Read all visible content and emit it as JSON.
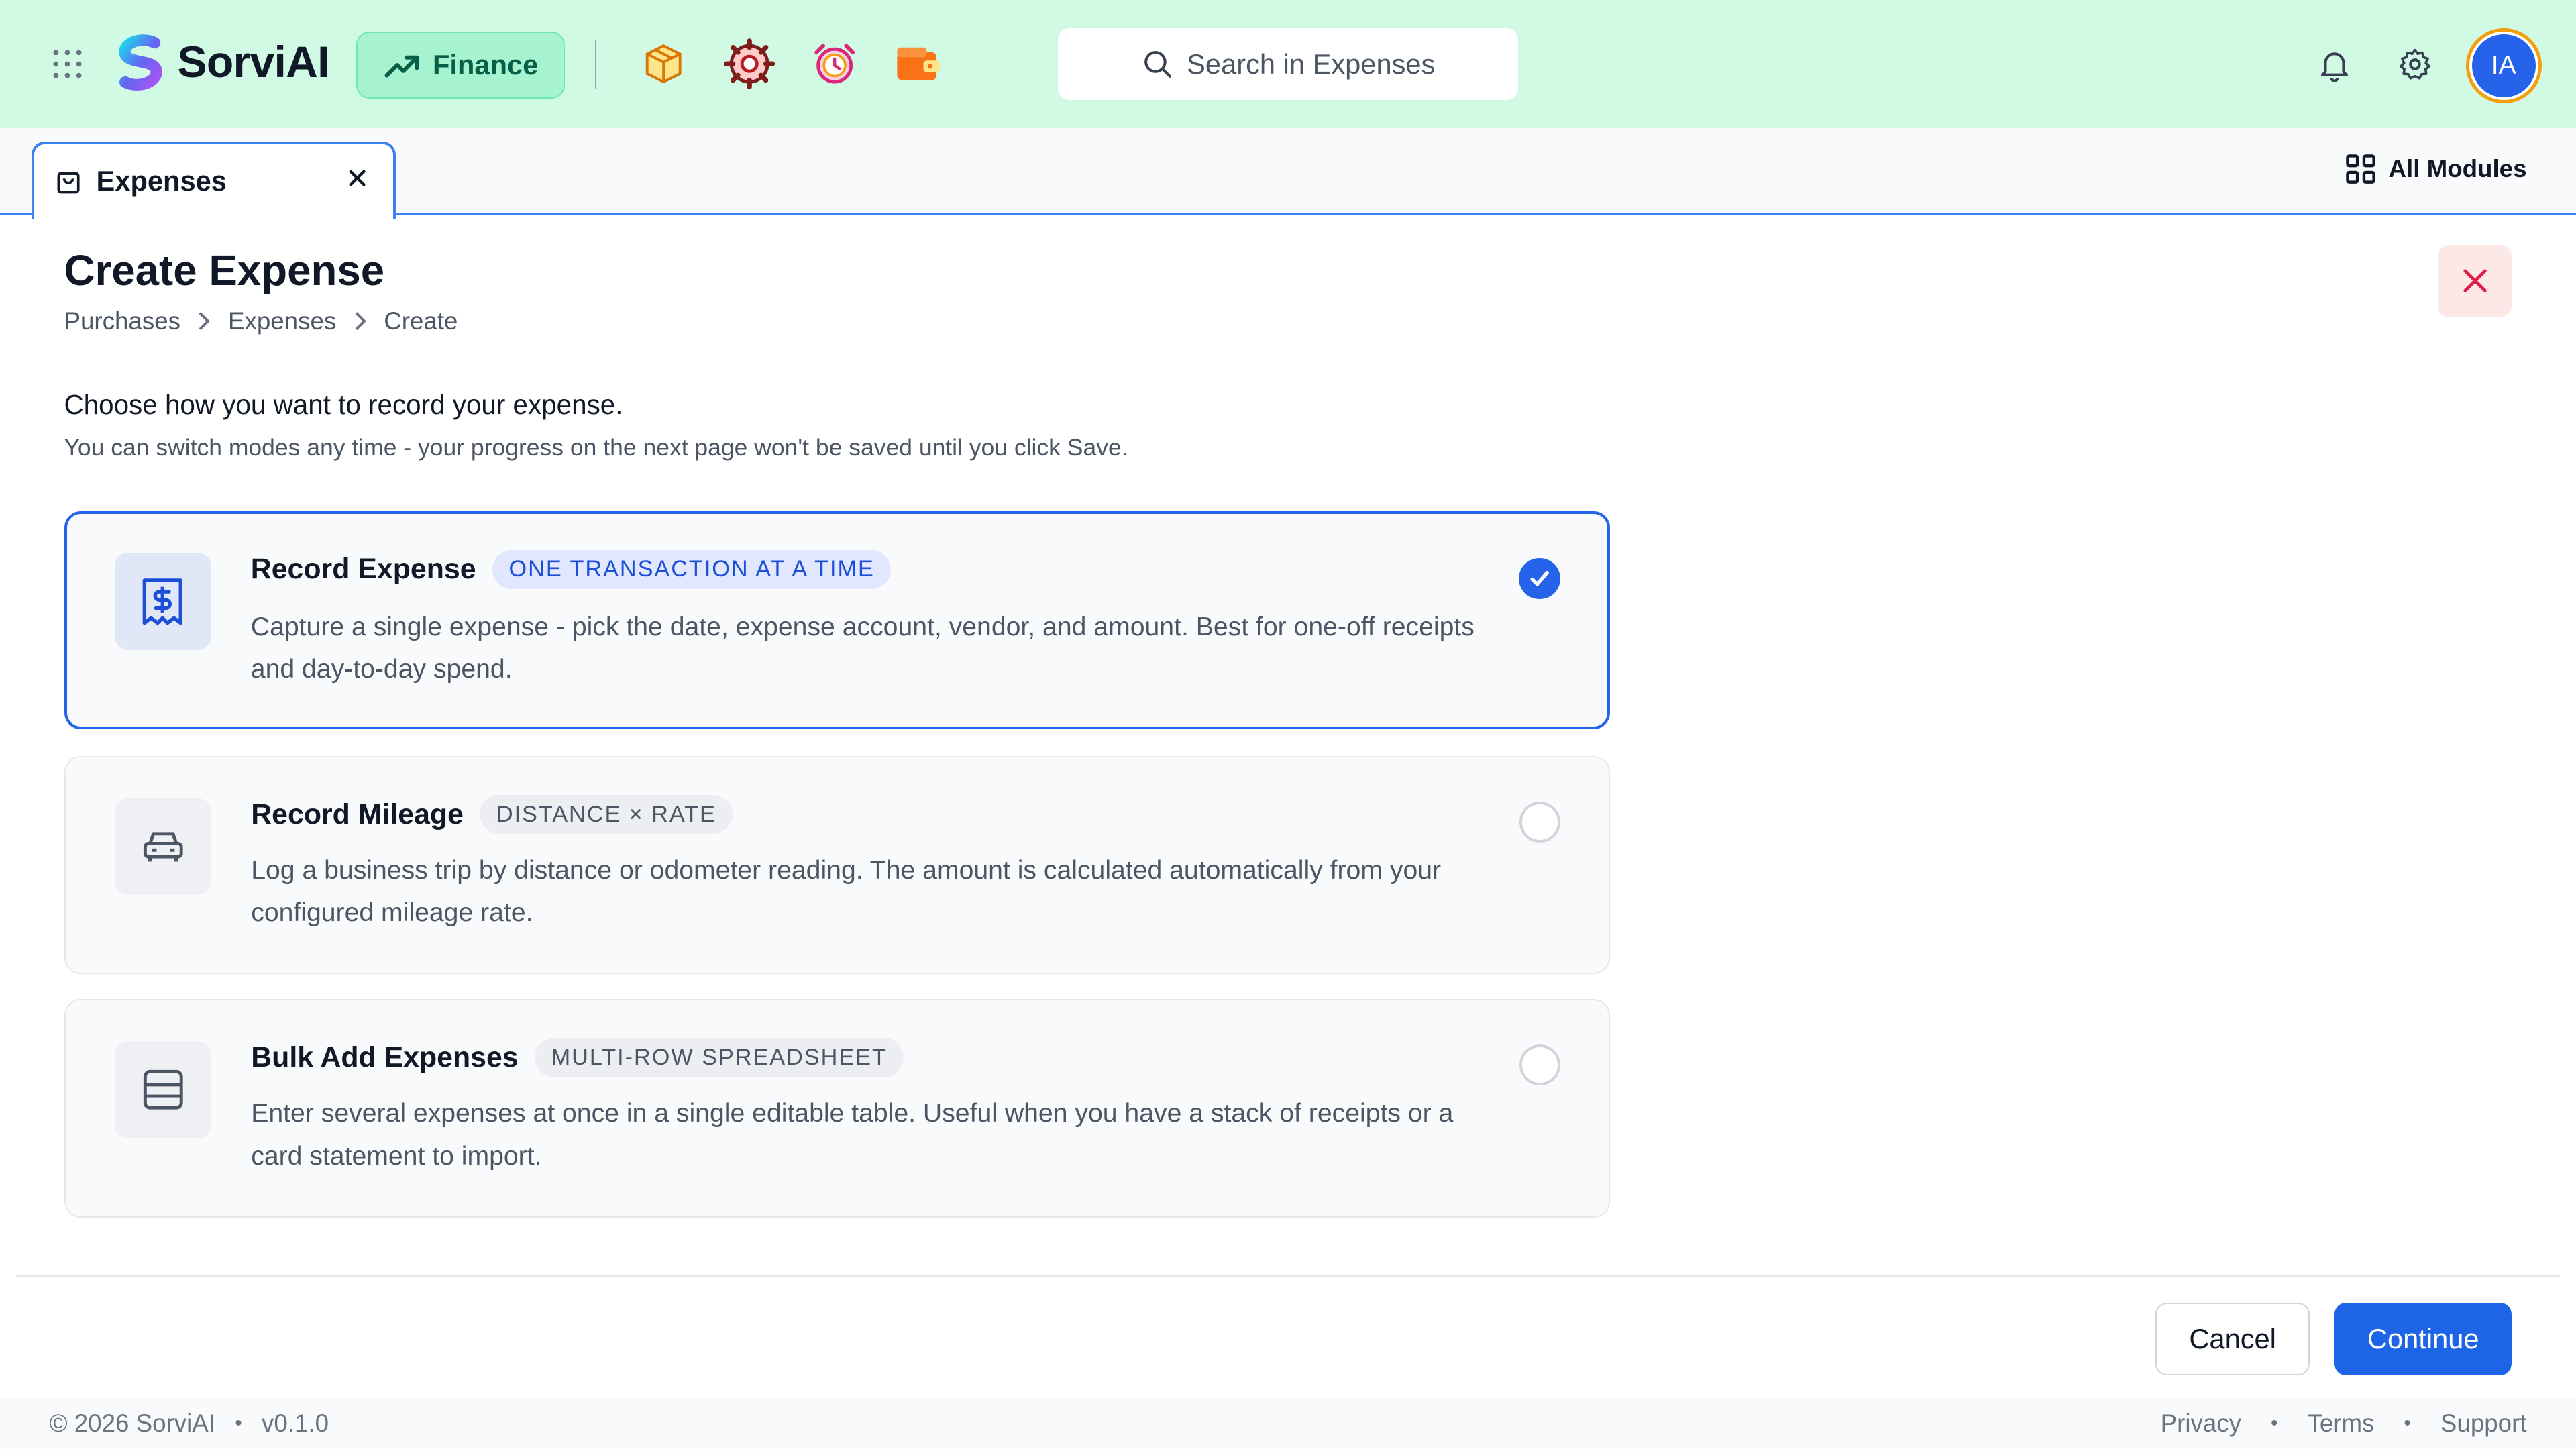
{
  "app": {
    "name": "SorviAI",
    "module": "Finance"
  },
  "search": {
    "placeholder": "Search in Expenses"
  },
  "user": {
    "initials": "IA"
  },
  "tab": {
    "label": "Expenses"
  },
  "all_modules": "All Modules",
  "page": {
    "title": "Create Expense",
    "breadcrumb": [
      "Purchases",
      "Expenses",
      "Create"
    ],
    "intro": "Choose how you want to record your expense.",
    "intro_sub": "You can switch modes any time - your progress on the next page won't be saved until you click Save."
  },
  "options": [
    {
      "title": "Record Expense",
      "badge": "ONE TRANSACTION AT A TIME",
      "description": "Capture a single expense - pick the date, expense account, vendor, and amount. Best for one-off receipts and day-to-day spend.",
      "selected": true
    },
    {
      "title": "Record Mileage",
      "badge": "DISTANCE × RATE",
      "description": "Log a business trip by distance or odometer reading. The amount is calculated automatically from your configured mileage rate.",
      "selected": false
    },
    {
      "title": "Bulk Add Expenses",
      "badge": "MULTI-ROW SPREADSHEET",
      "description": "Enter several expenses at once in a single editable table. Useful when you have a stack of receipts or a card statement to import.",
      "selected": false
    }
  ],
  "actions": {
    "cancel": "Cancel",
    "continue": "Continue"
  },
  "footer": {
    "copyright": "© 2026 SorviAI",
    "version": "v0.1.0",
    "links": [
      "Privacy",
      "Terms",
      "Support"
    ]
  },
  "colors": {
    "accent": "#2563eb",
    "topbar": "#d1fae5",
    "finance_pill": "#a7f3d0"
  }
}
